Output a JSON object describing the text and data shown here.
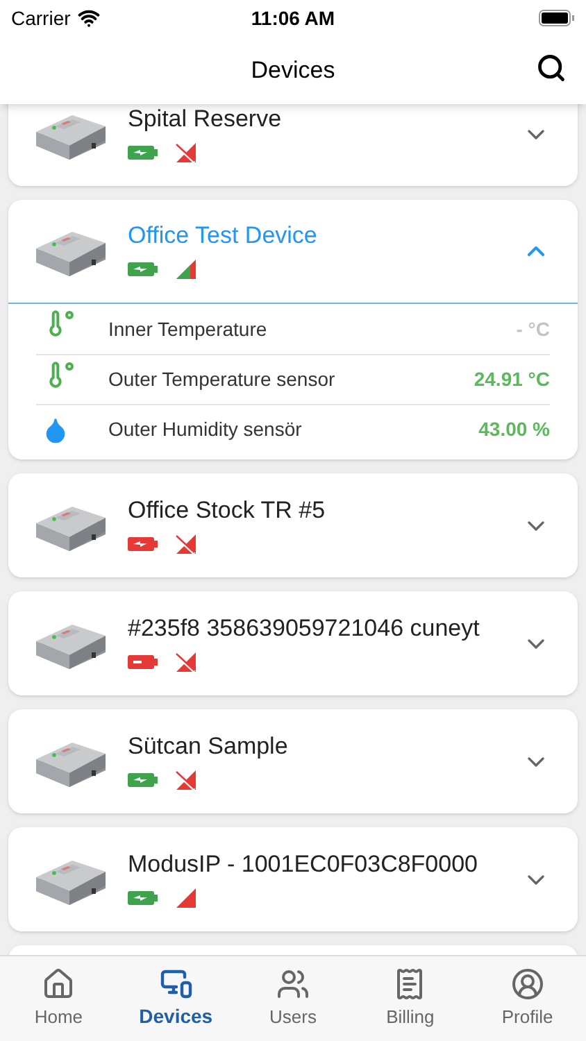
{
  "status_bar": {
    "carrier": "Carrier",
    "time": "11:06 AM"
  },
  "header": {
    "title": "Devices"
  },
  "devices": [
    {
      "name": "Spital Reserve",
      "expanded": false,
      "battery_low": false,
      "charging": true,
      "no_signal": true,
      "signal_partial": false
    },
    {
      "name": "Office Test Device",
      "expanded": true,
      "battery_low": false,
      "charging": true,
      "no_signal": false,
      "signal_partial": true,
      "sensors": [
        {
          "kind": "temperature",
          "label": "Inner Temperature",
          "value": "- °C",
          "active": false
        },
        {
          "kind": "temperature",
          "label": "Outer Temperature sensor",
          "value": "24.91 °C",
          "active": true
        },
        {
          "kind": "humidity",
          "label": "Outer Humidity sensör",
          "value": "43.00 %",
          "active": true
        }
      ]
    },
    {
      "name": "Office Stock TR #5",
      "expanded": false,
      "battery_low": true,
      "charging": true,
      "no_signal": true,
      "signal_partial": false
    },
    {
      "name": "#235f8 358639059721046 cuneyt",
      "expanded": false,
      "battery_low": true,
      "charging": false,
      "no_signal": true,
      "signal_partial": false
    },
    {
      "name": "Sütcan Sample",
      "expanded": false,
      "battery_low": false,
      "charging": true,
      "no_signal": true,
      "signal_partial": false
    },
    {
      "name": "ModusIP - 1001EC0F03C8F0000",
      "expanded": false,
      "battery_low": false,
      "charging": true,
      "no_signal": false,
      "signal_partial": false
    }
  ],
  "tabs": [
    {
      "label": "Home",
      "selected": false
    },
    {
      "label": "Devices",
      "selected": true
    },
    {
      "label": "Users",
      "selected": false
    },
    {
      "label": "Billing",
      "selected": false
    },
    {
      "label": "Profile",
      "selected": false
    }
  ]
}
